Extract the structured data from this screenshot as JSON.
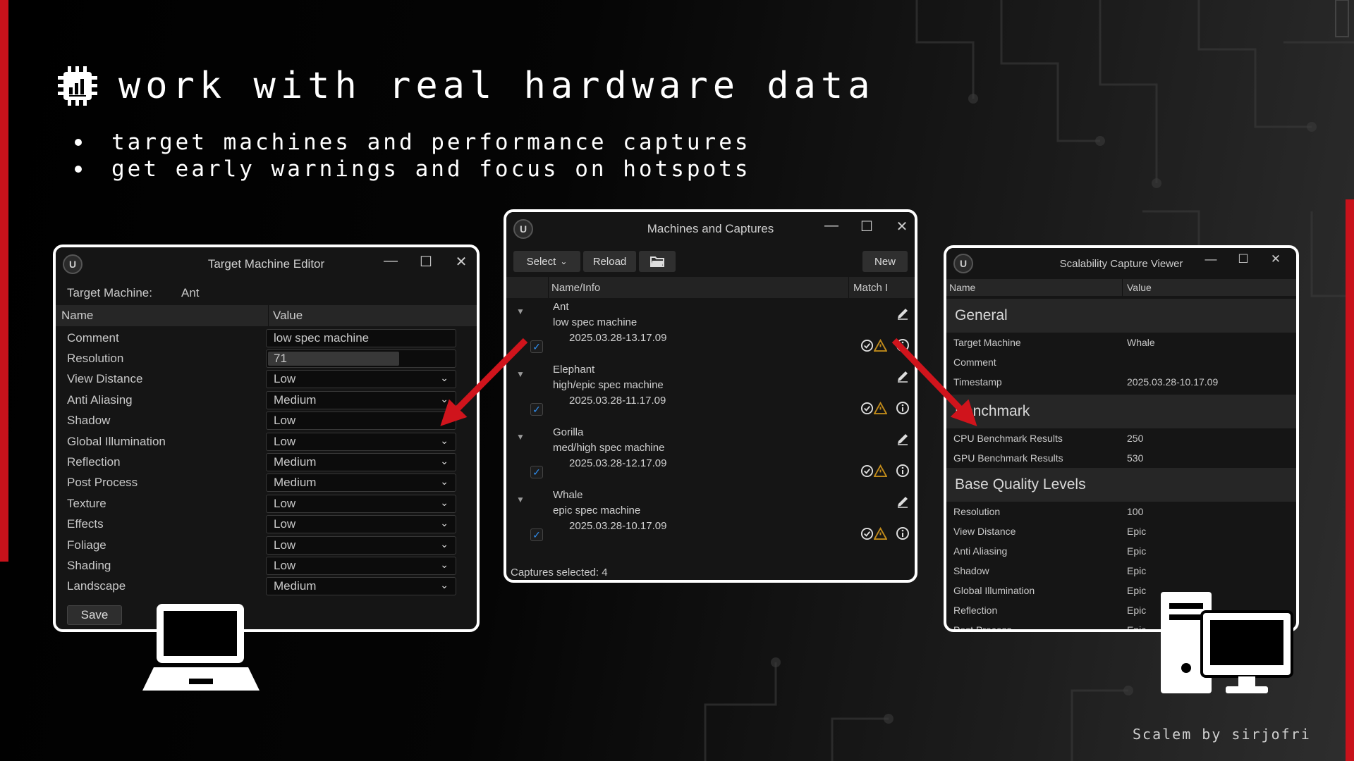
{
  "headline": "work with real hardware data",
  "bullets": [
    "target machines and performance captures",
    "get early warnings and focus on hotspots"
  ],
  "credit": "Scalem by sirjofri",
  "colors": {
    "accent_red": "#c8121b",
    "check_blue": "#2f8ef0",
    "warning_amber": "#c08a1a"
  },
  "target_machine_editor": {
    "title": "Target Machine Editor",
    "target_label": "Target Machine:",
    "target_value": "Ant",
    "col_name": "Name",
    "col_value": "Value",
    "rows": [
      {
        "name": "Comment",
        "value": "low spec machine"
      },
      {
        "name": "Resolution",
        "value": "71"
      },
      {
        "name": "View Distance",
        "value": "Low"
      },
      {
        "name": "Anti Aliasing",
        "value": "Medium"
      },
      {
        "name": "Shadow",
        "value": "Low"
      },
      {
        "name": "Global Illumination",
        "value": "Low"
      },
      {
        "name": "Reflection",
        "value": "Medium"
      },
      {
        "name": "Post Process",
        "value": "Medium"
      },
      {
        "name": "Texture",
        "value": "Low"
      },
      {
        "name": "Effects",
        "value": "Low"
      },
      {
        "name": "Foliage",
        "value": "Low"
      },
      {
        "name": "Shading",
        "value": "Low"
      },
      {
        "name": "Landscape",
        "value": "Medium"
      }
    ],
    "save_label": "Save"
  },
  "machines_and_captures": {
    "title": "Machines and Captures",
    "toolbar": {
      "select": "Select",
      "reload": "Reload",
      "new": "New"
    },
    "col_name": "Name/Info",
    "col_match": "Match I",
    "captures": [
      {
        "name": "Ant",
        "desc": "low spec machine",
        "timestamp": "2025.03.28-13.17.09",
        "checked": "✓"
      },
      {
        "name": "Elephant",
        "desc": "high/epic spec machine",
        "timestamp": "2025.03.28-11.17.09",
        "checked": "✓"
      },
      {
        "name": "Gorilla",
        "desc": "med/high spec machine",
        "timestamp": "2025.03.28-12.17.09",
        "checked": "✓"
      },
      {
        "name": "Whale",
        "desc": "epic spec machine",
        "timestamp": "2025.03.28-10.17.09",
        "checked": "✓"
      }
    ],
    "footer": "Captures selected: 4"
  },
  "scalability_capture_viewer": {
    "title": "Scalability Capture Viewer",
    "col_name": "Name",
    "col_value": "Value",
    "general": {
      "title": "General",
      "rows": [
        {
          "k": "Target Machine",
          "v": "Whale"
        },
        {
          "k": "Comment",
          "v": ""
        },
        {
          "k": "Timestamp",
          "v": "2025.03.28-10.17.09"
        }
      ]
    },
    "benchmark": {
      "title": "Benchmark",
      "rows": [
        {
          "k": "CPU Benchmark Results",
          "v": "250"
        },
        {
          "k": "GPU Benchmark Results",
          "v": "530"
        }
      ]
    },
    "base_quality": {
      "title": "Base Quality Levels",
      "rows": [
        {
          "k": "Resolution",
          "v": "100"
        },
        {
          "k": "View Distance",
          "v": "Epic"
        },
        {
          "k": "Anti Aliasing",
          "v": "Epic"
        },
        {
          "k": "Shadow",
          "v": "Epic"
        },
        {
          "k": "Global Illumination",
          "v": "Epic"
        },
        {
          "k": "Reflection",
          "v": "Epic"
        },
        {
          "k": "Post Process",
          "v": "Epic"
        }
      ]
    }
  }
}
